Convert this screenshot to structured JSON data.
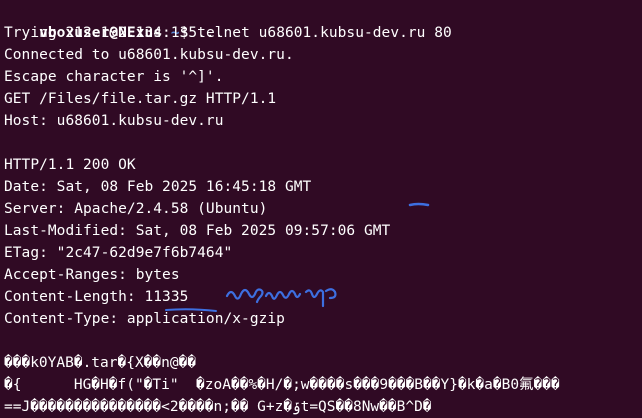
{
  "terminal": {
    "prompt": {
      "user_host": "vboxuser@NExus",
      "separator": ":",
      "path": "~",
      "symbol": "$ ",
      "command": "telnet u68601.kubsu-dev.ru 80"
    },
    "lines": [
      "Trying 212.192.134.135...",
      "Connected to u68601.kubsu-dev.ru.",
      "Escape character is '^]'.",
      "GET /Files/file.tar.gz HTTP/1.1",
      "Host: u68601.kubsu-dev.ru",
      "",
      "HTTP/1.1 200 OK",
      "Date: Sat, 08 Feb 2025 16:45:18 GMT",
      "Server: Apache/2.4.58 (Ubuntu)",
      "Last-Modified: Sat, 08 Feb 2025 09:57:06 GMT",
      "ETag: \"2c47-62d9e7f6b7464\"",
      "Accept-Ranges: bytes",
      "Content-Length: 11335",
      "Content-Type: application/x-gzip",
      "",
      "���k0YAB�.tar�{X��n@��",
      "�{      HG�H�f(\"�Ti\"  �zoA��%�H/�;w����s���9���B��Y}�k�a�B0氟���",
      "==J���������������<2����n;�� G+z�ݹt=QS��8Nw��B^D�"
    ],
    "annotation": {
      "handwritten_text": "размер",
      "color": "#3d6fe0"
    }
  }
}
